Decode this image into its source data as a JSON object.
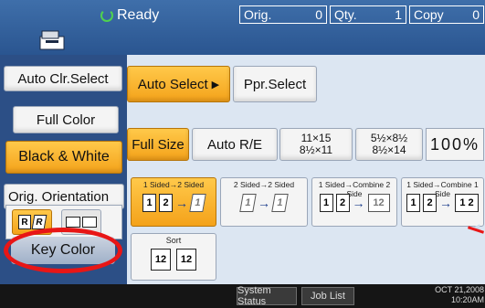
{
  "status": {
    "ready_text": "Ready",
    "orig_label": "Orig.",
    "orig_value": "0",
    "qty_label": "Qty.",
    "qty_value": "1",
    "copy_label": "Copy",
    "copy_value": "0"
  },
  "color_mode": {
    "auto_label": "Auto Clr.Select",
    "full_label": "Full Color",
    "bw_label": "Black & White",
    "selected": "Black & White"
  },
  "orientation": {
    "label": "Orig. Orientation",
    "letter": "R"
  },
  "key_color": {
    "label": "Key Color"
  },
  "paper": {
    "auto_select_label": "Auto Select",
    "auto_select_arrow": "▶",
    "ppr_select_label": "Ppr.Select"
  },
  "reduce": {
    "full_size_label": "Full Size",
    "auto_re_label": "Auto R/E",
    "preset1_top": "11×15",
    "preset1_bottom": "8½×11",
    "preset2_top": "5½×8½",
    "preset2_bottom": "8½×14",
    "percent": "100%"
  },
  "duplex": [
    {
      "label": "1 Sided→2 Sided",
      "active": true
    },
    {
      "label": "2 Sided→2 Sided",
      "active": false
    },
    {
      "label": "1 Sided→Combine 2 Side",
      "active": false
    },
    {
      "label": "1 Sided→Combine 1 Side",
      "active": false
    }
  ],
  "sort": {
    "label": "Sort"
  },
  "bottom": {
    "system_status": "System Status",
    "job_list": "Job List",
    "date": "OCT 21,2008",
    "time": "10:20AM"
  },
  "colors": {
    "accent": "#f4a21a",
    "panel": "#2c4f86",
    "highlight_ring": "#e81616"
  }
}
